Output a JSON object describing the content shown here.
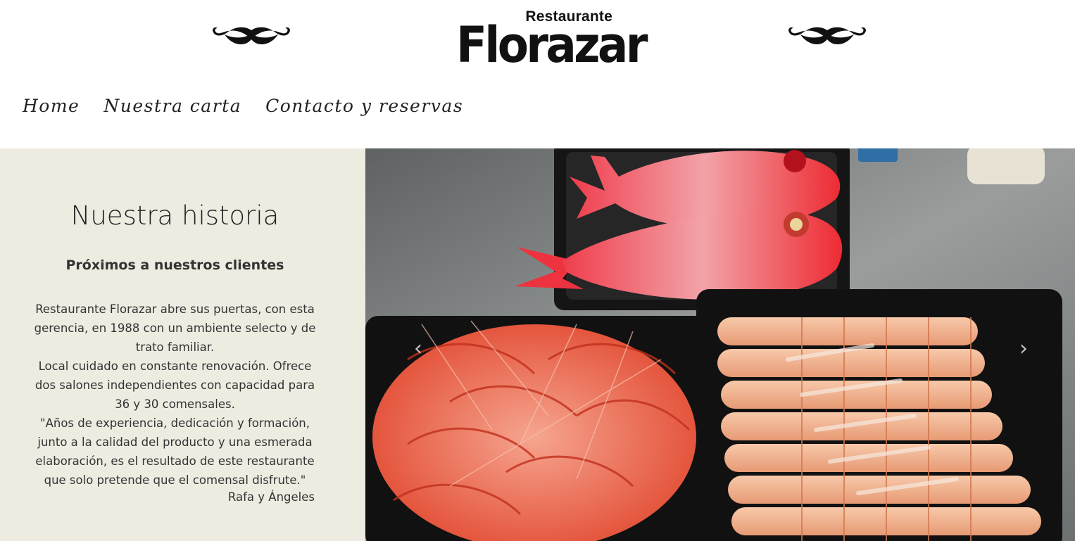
{
  "header": {
    "logo_top": "Restaurante",
    "logo_main": "Florazar"
  },
  "nav": {
    "items": [
      "Home",
      "Nuestra carta",
      "Contacto y reservas"
    ]
  },
  "story": {
    "title": "Nuestra historia",
    "subtitle": "Próximos a nuestros clientes",
    "paragraph_1": "Restaurante Florazar abre sus puertas, con esta gerencia, en 1988 con un ambiente selecto y de trato familiar.",
    "paragraph_2": "Local cuidado en constante renovación. Ofrece dos salones independientes con capacidad para 36 y 30 comensales.",
    "quote": "\"Años de experiencia, dedicación y formación, junto a la calidad del producto y una esmerada elaboración, es el resultado de este restaurante que solo pretende que el comensal disfrute.\"",
    "signature": "Rafa y Ángeles"
  },
  "slider": {
    "prev_icon": "chevron-left-icon",
    "next_icon": "chevron-right-icon",
    "prev_glyph": "‹",
    "next_glyph": "›"
  },
  "colors": {
    "panel_bg": "#eeebe1",
    "text": "#222222"
  }
}
